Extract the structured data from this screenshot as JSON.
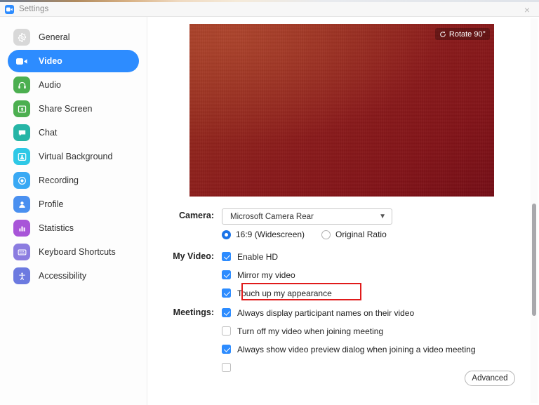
{
  "window": {
    "title": "Settings",
    "app_icon": "zoom-video-icon",
    "close_icon": "×"
  },
  "sidebar": {
    "items": [
      {
        "label": "General",
        "icon": "gear-icon",
        "color": "#d8d8d8",
        "active": false
      },
      {
        "label": "Video",
        "icon": "video-camera-icon",
        "color": "#2d8cff",
        "active": true
      },
      {
        "label": "Audio",
        "icon": "headphones-icon",
        "color": "#4caf50",
        "active": false
      },
      {
        "label": "Share Screen",
        "icon": "share-screen-icon",
        "color": "#4caf50",
        "active": false
      },
      {
        "label": "Chat",
        "icon": "chat-bubble-icon",
        "color": "#26b5a6",
        "active": false
      },
      {
        "label": "Virtual Background",
        "icon": "virtual-background-icon",
        "color": "#2ec8e6",
        "active": false
      },
      {
        "label": "Recording",
        "icon": "record-circle-icon",
        "color": "#39a9f4",
        "active": false
      },
      {
        "label": "Profile",
        "icon": "person-icon",
        "color": "#4a90f0",
        "active": false
      },
      {
        "label": "Statistics",
        "icon": "bar-chart-icon",
        "color": "#a855d8",
        "active": false
      },
      {
        "label": "Keyboard Shortcuts",
        "icon": "keyboard-icon",
        "color": "#8b7ce0",
        "active": false
      },
      {
        "label": "Accessibility",
        "icon": "accessibility-icon",
        "color": "#6c7ae0",
        "active": false
      }
    ]
  },
  "preview": {
    "rotate_label": "Rotate 90°",
    "rotate_icon": "rotate-icon",
    "gradient_from": "#9c3320",
    "gradient_to": "#750d16"
  },
  "camera": {
    "label": "Camera:",
    "selected": "Microsoft Camera Rear",
    "caret_icon": "chevron-down-icon",
    "ratio_options": [
      {
        "label": "16:9 (Widescreen)",
        "checked": true
      },
      {
        "label": "Original Ratio",
        "checked": false
      }
    ]
  },
  "my_video": {
    "label": "My Video:",
    "options": [
      {
        "label": "Enable HD",
        "checked": true,
        "highlighted": false
      },
      {
        "label": "Mirror my video",
        "checked": true,
        "highlighted": false
      },
      {
        "label": "Touch up my appearance",
        "checked": true,
        "highlighted": true
      }
    ]
  },
  "meetings": {
    "label": "Meetings:",
    "options": [
      {
        "label": "Always display participant names on their video",
        "checked": true
      },
      {
        "label": "Turn off my video when joining meeting",
        "checked": false
      },
      {
        "label": "Always show video preview dialog when joining a video meeting",
        "checked": true
      }
    ]
  },
  "footer": {
    "advanced_label": "Advanced"
  },
  "highlight": {
    "color": "#e01b1b"
  }
}
